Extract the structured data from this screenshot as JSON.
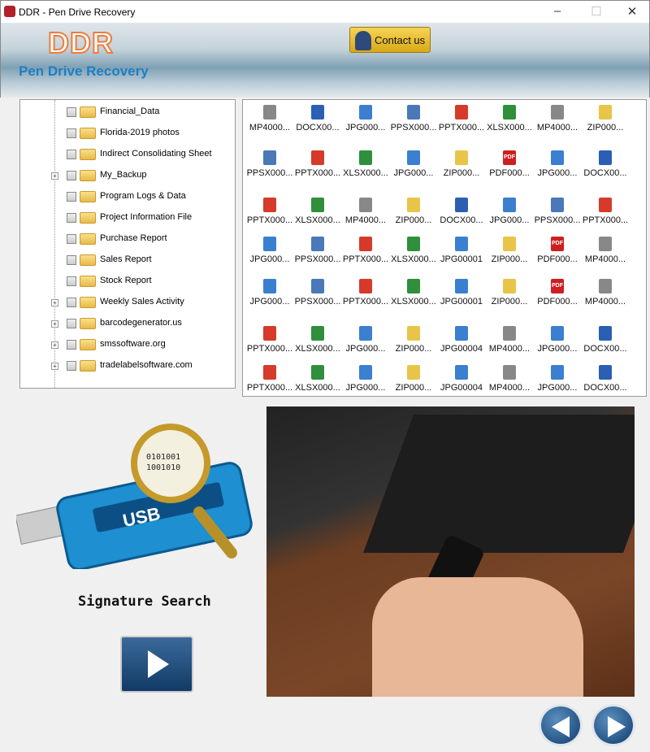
{
  "window": {
    "title": "DDR - Pen Drive Recovery",
    "minimize": "–",
    "maximize": "☐",
    "close": "✕"
  },
  "header": {
    "logo": "DDR",
    "subtitle": "Pen Drive Recovery",
    "contact_label": "Contact us"
  },
  "tree": [
    {
      "label": "Financial_Data",
      "expandable": false
    },
    {
      "label": "Florida-2019 photos",
      "expandable": false
    },
    {
      "label": "Indirect Consolidating Sheet",
      "expandable": false
    },
    {
      "label": "My_Backup",
      "expandable": true
    },
    {
      "label": "Program Logs & Data",
      "expandable": false
    },
    {
      "label": "Project Information File",
      "expandable": false
    },
    {
      "label": "Purchase Report",
      "expandable": false
    },
    {
      "label": "Sales Report",
      "expandable": false
    },
    {
      "label": "Stock Report",
      "expandable": false
    },
    {
      "label": "Weekly Sales Activity",
      "expandable": true
    },
    {
      "label": "barcodegenerator.us",
      "expandable": true
    },
    {
      "label": "smssoftware.org",
      "expandable": true
    },
    {
      "label": "tradelabelsoftware.com",
      "expandable": true
    }
  ],
  "file_rows": [
    [
      "MP4000...",
      "DOCX00...",
      "JPG000...",
      "PPSX000...",
      "PPTX000...",
      "XLSX000...",
      "MP4000...",
      "ZIP000..."
    ],
    [
      "PPSX000...",
      "PPTX000...",
      "XLSX000...",
      "JPG000...",
      "ZIP000...",
      "PDF000...",
      "JPG000...",
      "DOCX00..."
    ],
    [
      "PPTX000...",
      "XLSX000...",
      "MP4000...",
      "ZIP000...",
      "DOCX00...",
      "JPG000...",
      "PPSX000...",
      "PPTX000..."
    ],
    [
      "JPG000...",
      "PPSX000...",
      "PPTX000...",
      "XLSX000...",
      "JPG00001",
      "ZIP000...",
      "PDF000...",
      "MP4000..."
    ],
    [
      "JPG000...",
      "PPSX000...",
      "PPTX000...",
      "XLSX000...",
      "JPG00001",
      "ZIP000...",
      "PDF000...",
      "MP4000..."
    ],
    [
      "PPTX000...",
      "XLSX000...",
      "JPG000...",
      "ZIP000...",
      "JPG00004",
      "MP4000...",
      "JPG000...",
      "DOCX00..."
    ],
    [
      "PPTX000...",
      "XLSX000...",
      "JPG000...",
      "ZIP000...",
      "JPG00004",
      "MP4000...",
      "JPG000...",
      "DOCX00..."
    ]
  ],
  "icon_colors": {
    "MP4": "#f07a1a",
    "DOCX": "#2b5fb4",
    "JPG": "#3b7fd0",
    "PPSX": "#4a78b8",
    "PPTX": "#d63a2a",
    "XLSX": "#2f8f3a",
    "ZIP": "#e8c548",
    "PDF": "#cc1f1f"
  },
  "main": {
    "mode_label": "Signature Search",
    "usb_label": "USB"
  }
}
